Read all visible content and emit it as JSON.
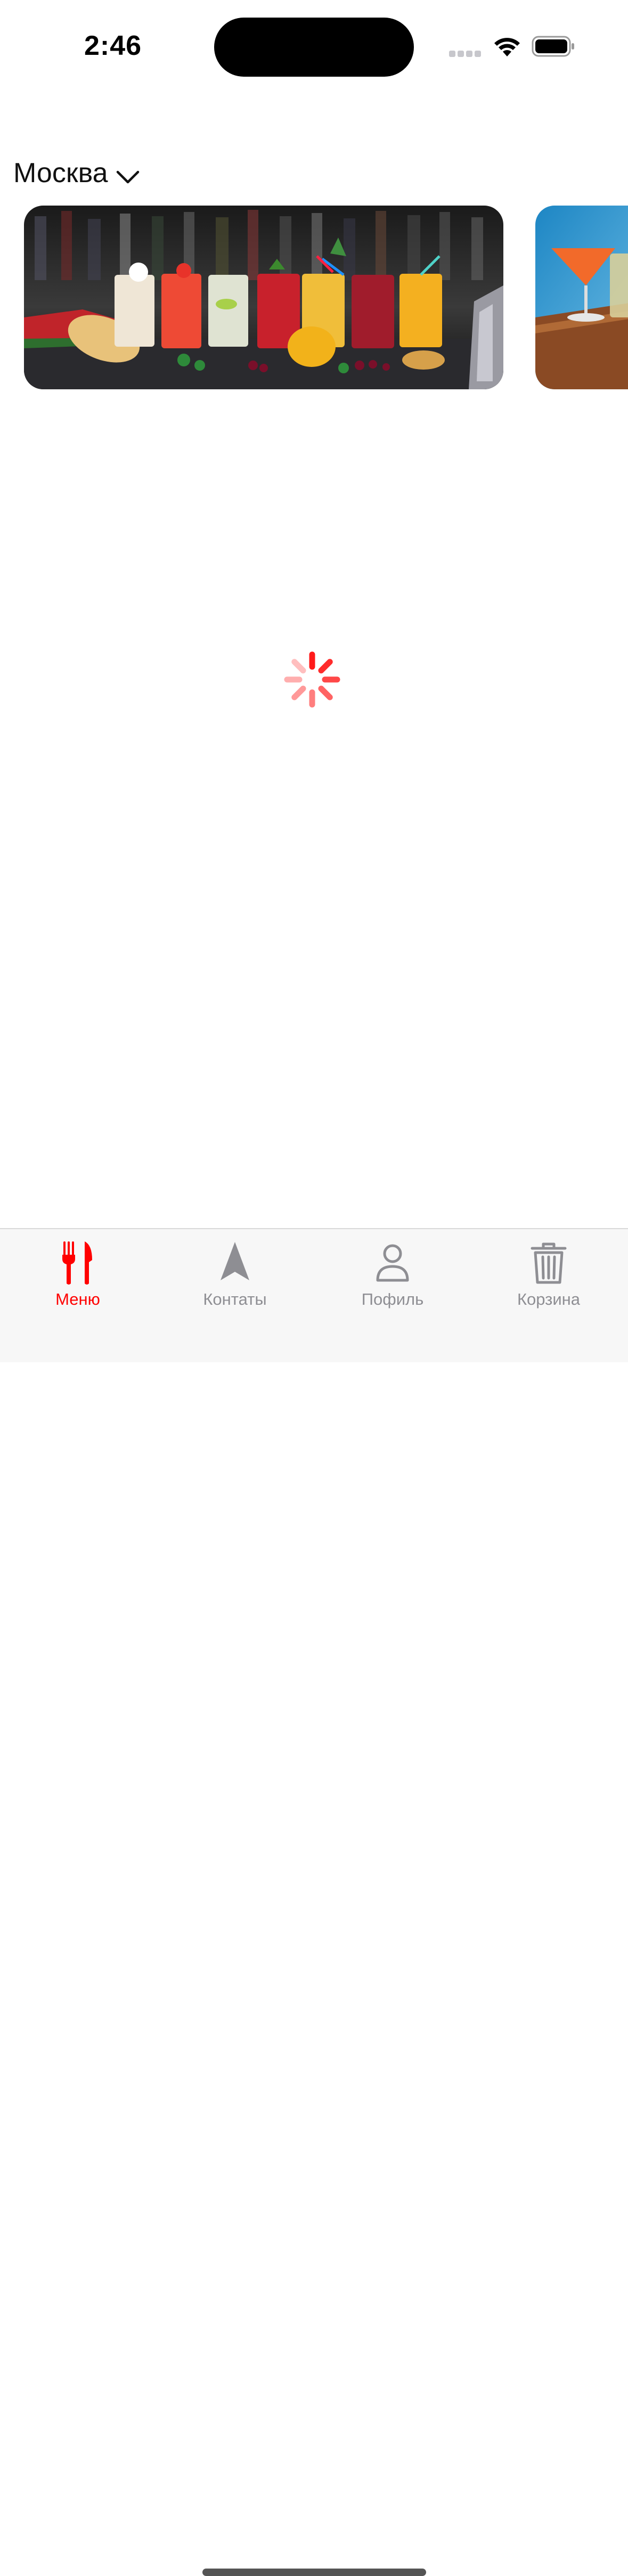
{
  "status_bar": {
    "time": "2:46"
  },
  "city_selector": {
    "city": "Москва",
    "icon": "chevron-down-icon"
  },
  "banners": [
    {
      "name": "drinks-banner"
    },
    {
      "name": "cocktail-banner"
    }
  ],
  "loading": {
    "icon": "loading-spinner-icon",
    "color": "#ff3b30"
  },
  "tab_bar": {
    "active_color": "#ff0000",
    "inactive_color": "#8e8e93",
    "tabs": [
      {
        "label": "Меню",
        "icon": "fork-knife-icon",
        "active": true
      },
      {
        "label": "Контаты",
        "icon": "location-arrow-icon",
        "active": false
      },
      {
        "label": "Пофиль",
        "icon": "person-icon",
        "active": false
      },
      {
        "label": "Корзина",
        "icon": "trash-icon",
        "active": false
      }
    ]
  }
}
